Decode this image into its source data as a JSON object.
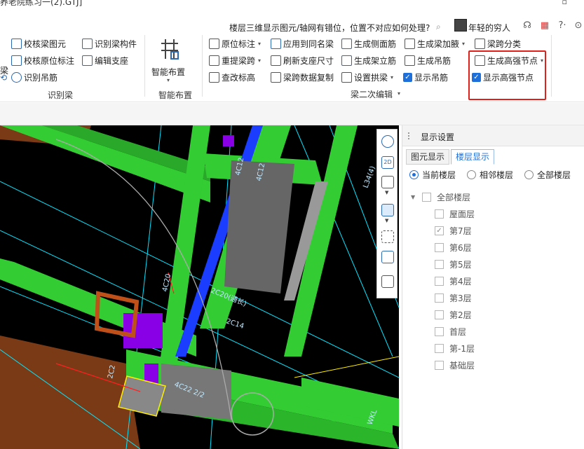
{
  "window": {
    "title": "养老院练习一(2).GTJ]",
    "maximize_glyph": "▫"
  },
  "helpbar": {
    "question": "楼层三维显示图元/轴网有错位，位置不对应如何处理?",
    "search_glyph": "⌕",
    "username": "年轻的穷人",
    "icons": [
      "headset-icon",
      "bell-icon",
      "calculator-icon",
      "help-icon",
      "more-icon"
    ],
    "help_label": "?·"
  },
  "ribbon": {
    "left_cut": [
      "梁",
      "⟲"
    ],
    "identify_beam": {
      "items": [
        "校核梁图元",
        "校核原位标注",
        "识别吊筋",
        "识别梁构件",
        "编辑支座"
      ],
      "group_label": "识别梁"
    },
    "smart_layout": {
      "button_label": "智能布置",
      "group_label": "智能布置"
    },
    "beam_edit": {
      "items": [
        "原位标注",
        "重提梁跨",
        "查改标高",
        "应用到同名梁",
        "刷新支座尺寸",
        "梁跨数据复制",
        "生成侧面筋",
        "生成架立筋",
        "设置拱梁",
        "生成梁加腋",
        "生成吊筋",
        "显示吊筋",
        "梁跨分类",
        "生成高强节点",
        "显示高强节点"
      ],
      "group_label": "梁二次编辑"
    }
  },
  "viewport_labels": [
    "4C12",
    "4C12",
    "L34(4)",
    "4C20",
    "2C20(通长)",
    "2C14",
    "4C22 2/2",
    "2C2",
    "WKL"
  ],
  "view_toolbar": {
    "btn_2d": "2D"
  },
  "display_panel": {
    "title": "显示设置",
    "tabs": [
      "图元显示",
      "楼层显示"
    ],
    "active_tab": 1,
    "radios": [
      {
        "label": "当前楼层",
        "checked": true
      },
      {
        "label": "相邻楼层",
        "checked": false
      },
      {
        "label": "全部楼层",
        "checked": false
      }
    ],
    "tree_root": "全部楼层",
    "floors": [
      {
        "label": "屋面层",
        "checked": false
      },
      {
        "label": "第7层",
        "checked": true
      },
      {
        "label": "第6层",
        "checked": false
      },
      {
        "label": "第5层",
        "checked": false
      },
      {
        "label": "第4层",
        "checked": false
      },
      {
        "label": "第3层",
        "checked": false
      },
      {
        "label": "第2层",
        "checked": false
      },
      {
        "label": "首层",
        "checked": false
      },
      {
        "label": "第-1层",
        "checked": false
      },
      {
        "label": "基础层",
        "checked": false
      }
    ]
  },
  "colors": {
    "accent": "#1e6fd9",
    "highlight_box": "#e0201a",
    "beam_green": "#33cc33",
    "column_purple": "#8a00e6",
    "cyan_line": "#00e5ff"
  }
}
